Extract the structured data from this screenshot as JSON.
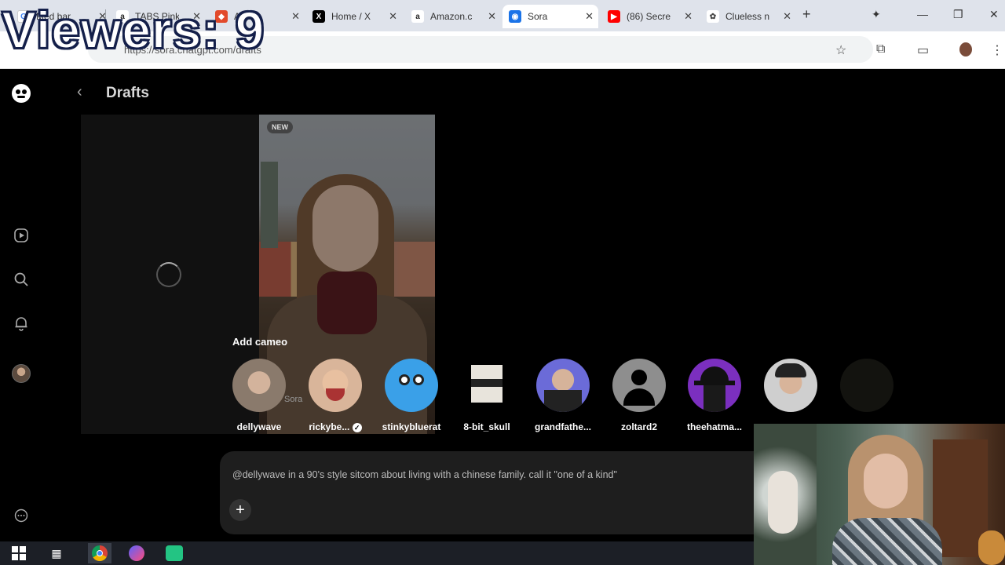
{
  "overlay": {
    "viewers": "Viewers: 9"
  },
  "browser": {
    "tabs": [
      {
        "label": "Med bar",
        "icon": "google-icon",
        "color": "#4285f4"
      },
      {
        "label": "TABS Pink",
        "icon": "amazon-icon",
        "color": "#222222"
      },
      {
        "label": "Ack",
        "icon": "app-icon",
        "color": "#e24a2b"
      },
      {
        "label": "Home / X",
        "icon": "x-icon",
        "color": "#000000"
      },
      {
        "label": "Amazon.c",
        "icon": "amazon-icon",
        "color": "#222222"
      },
      {
        "label": "Sora",
        "icon": "sora-icon",
        "color": "#1a73e8"
      },
      {
        "label": "(86) Secre",
        "icon": "youtube-icon",
        "color": "#ff0000"
      },
      {
        "label": "Clueless n",
        "icon": "openai-icon",
        "color": "#444444"
      }
    ],
    "url": "https://sora.chatgpt.com/drafts"
  },
  "app": {
    "title": "Drafts",
    "new_badge": "NEW",
    "cameo_heading": "Add cameo",
    "cameos": [
      {
        "name": "dellywave",
        "color": "#8a7a6c"
      },
      {
        "name": "rickybe...",
        "color": "#d9b59a",
        "verified": true
      },
      {
        "name": "stinkybluerat",
        "color": "#3aa0e8"
      },
      {
        "name": "8-bit_skull",
        "color": "#e8e4dc"
      },
      {
        "name": "grandfathe...",
        "color": "#6b6bd8"
      },
      {
        "name": "zoltard2",
        "color": "#8e8e8e"
      },
      {
        "name": "theehatma...",
        "color": "#7b2fbf"
      },
      {
        "name": "",
        "color": "#cfcfcf"
      }
    ],
    "watermark": "Sora",
    "prompt_text": "@dellywave in a 90's style sitcom about living with a chinese family.  call it \"one of a kind\""
  }
}
